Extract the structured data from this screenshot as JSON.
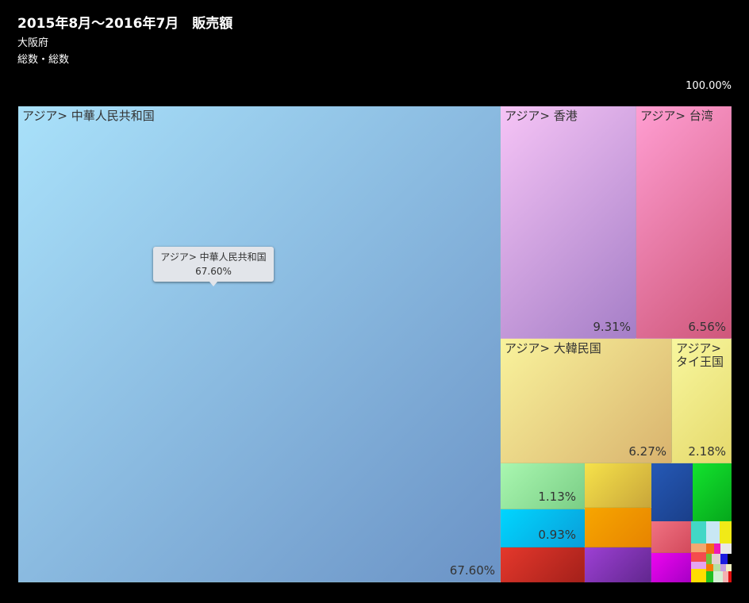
{
  "header": {
    "title": "2015年8月～2016年7月　販売額",
    "subtitle1": "大阪府",
    "subtitle2": "総数・総数",
    "total": "100.00%"
  },
  "tooltip": {
    "label": "アジア> 中華人民共和国",
    "value": "67.60%"
  },
  "chart_data": {
    "type": "treemap",
    "title": "2015年8月～2016年7月　販売額",
    "subtitle": [
      "大阪府",
      "総数・総数"
    ],
    "total_label": "100.00%",
    "items": [
      {
        "label": "アジア> 中華人民共和国",
        "value": 67.6,
        "value_label": "67.60%",
        "colors": [
          "#a9e1fa",
          "#6b93c6"
        ]
      },
      {
        "label": "アジア> 香港",
        "value": 9.31,
        "value_label": "9.31%",
        "colors": [
          "#f6c4f6",
          "#a57ec7"
        ]
      },
      {
        "label": "アジア> 台湾",
        "value": 6.56,
        "value_label": "6.56%",
        "colors": [
          "#ff9ed2",
          "#cf577a"
        ]
      },
      {
        "label": "アジア> 大韓民国",
        "value": 6.27,
        "value_label": "6.27%",
        "colors": [
          "#f9f39c",
          "#d9b36e"
        ]
      },
      {
        "label": "アジア>\nタイ王国",
        "value": 2.18,
        "value_label": "2.18%",
        "colors": [
          "#f8f79e",
          "#e5d96c"
        ]
      },
      {
        "label": "",
        "value": 1.13,
        "value_label": "1.13%",
        "colors": [
          "#a9f7b0",
          "#7bce86"
        ]
      },
      {
        "label": "",
        "value": 0.93,
        "value_label": "0.93%",
        "colors": [
          "#00d6ff",
          "#0a9ed9"
        ]
      },
      {
        "label": "",
        "value": 0.88,
        "value_label": "",
        "colors": [
          "#f6e24a",
          "#c9a63a"
        ]
      },
      {
        "label": "",
        "value": 0.78,
        "value_label": "",
        "colors": [
          "#2559b6",
          "#1a3f8a"
        ]
      },
      {
        "label": "",
        "value": 0.78,
        "value_label": "",
        "colors": [
          "#13e32e",
          "#06a81c"
        ]
      },
      {
        "label": "",
        "value": 0.7,
        "value_label": "",
        "colors": [
          "#f7a600",
          "#e78400"
        ]
      },
      {
        "label": "",
        "value": 0.64,
        "value_label": "",
        "colors": [
          "#e5382c",
          "#a4201a"
        ]
      },
      {
        "label": "",
        "value": 0.62,
        "value_label": "",
        "colors": [
          "#9d40d4",
          "#62278f"
        ]
      },
      {
        "label": "",
        "value": 0.48,
        "value_label": "",
        "colors": [
          "#f07282",
          "#d34a5c"
        ]
      },
      {
        "label": "",
        "value": 0.45,
        "value_label": "",
        "colors": [
          "#ee05ef",
          "#a800c6"
        ]
      },
      {
        "label": "",
        "value": 0.42,
        "value_label": "",
        "colors": [
          "#42d7c6"
        ]
      }
    ],
    "small_cells": [
      {
        "colors": [
          "#42d7c6"
        ]
      },
      {
        "colors": [
          "#c8e7f4"
        ]
      },
      {
        "colors": [
          "#f1ea17"
        ]
      },
      {
        "colors": [
          "#f2a870"
        ]
      },
      {
        "colors": [
          "#f06f14"
        ]
      },
      {
        "colors": [
          "#f018b5"
        ]
      },
      {
        "colors": [
          "#e8e8e8"
        ]
      },
      {
        "colors": [
          "#f54c4c"
        ]
      },
      {
        "colors": [
          "#72c23a"
        ]
      },
      {
        "colors": [
          "#e2d0d0"
        ]
      },
      {
        "colors": [
          "#1a1adf"
        ]
      },
      {
        "colors": [
          "#e6a5f0"
        ]
      },
      {
        "colors": [
          "#f57c00"
        ]
      },
      {
        "colors": [
          "#b5e0a0"
        ]
      },
      {
        "colors": [
          "#c69ee0"
        ]
      },
      {
        "colors": [
          "#f0f0c0"
        ]
      },
      {
        "colors": [
          "#ffdd00"
        ]
      },
      {
        "colors": [
          "#20c020"
        ]
      },
      {
        "colors": [
          "#d4f0d4"
        ]
      },
      {
        "colors": [
          "#f4b0b0"
        ]
      },
      {
        "colors": [
          "#e01010"
        ]
      }
    ]
  }
}
